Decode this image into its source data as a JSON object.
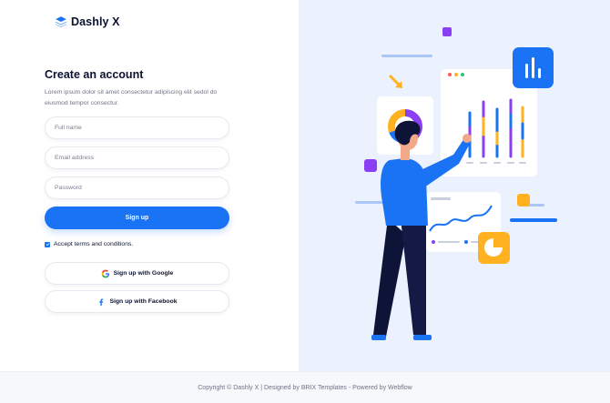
{
  "brand": {
    "name": "Dashly X",
    "accent": "#1a73f4"
  },
  "form": {
    "title": "Create an account",
    "subtitle": "Lorem ipsum dolor sit amet consectetur adipiscing elit sedol do eiusmod tempor consectur.",
    "fullname_placeholder": "Full name",
    "email_placeholder": "Email address",
    "password_placeholder": "Password",
    "signup_label": "Sign up",
    "terms_label": "Accept terms and conditions.",
    "terms_checked": true,
    "google_label": "Sign up with Google",
    "facebook_label": "Sign up with Facebook"
  },
  "footer": {
    "text": "Copyright © Dashly X | Designed by BRIX Templates - Powered by Webflow"
  },
  "colors": {
    "illustration_bg": "#ebf1fd",
    "purple": "#8b3ff2",
    "orange": "#ffb11f",
    "blue": "#1a73f4"
  }
}
